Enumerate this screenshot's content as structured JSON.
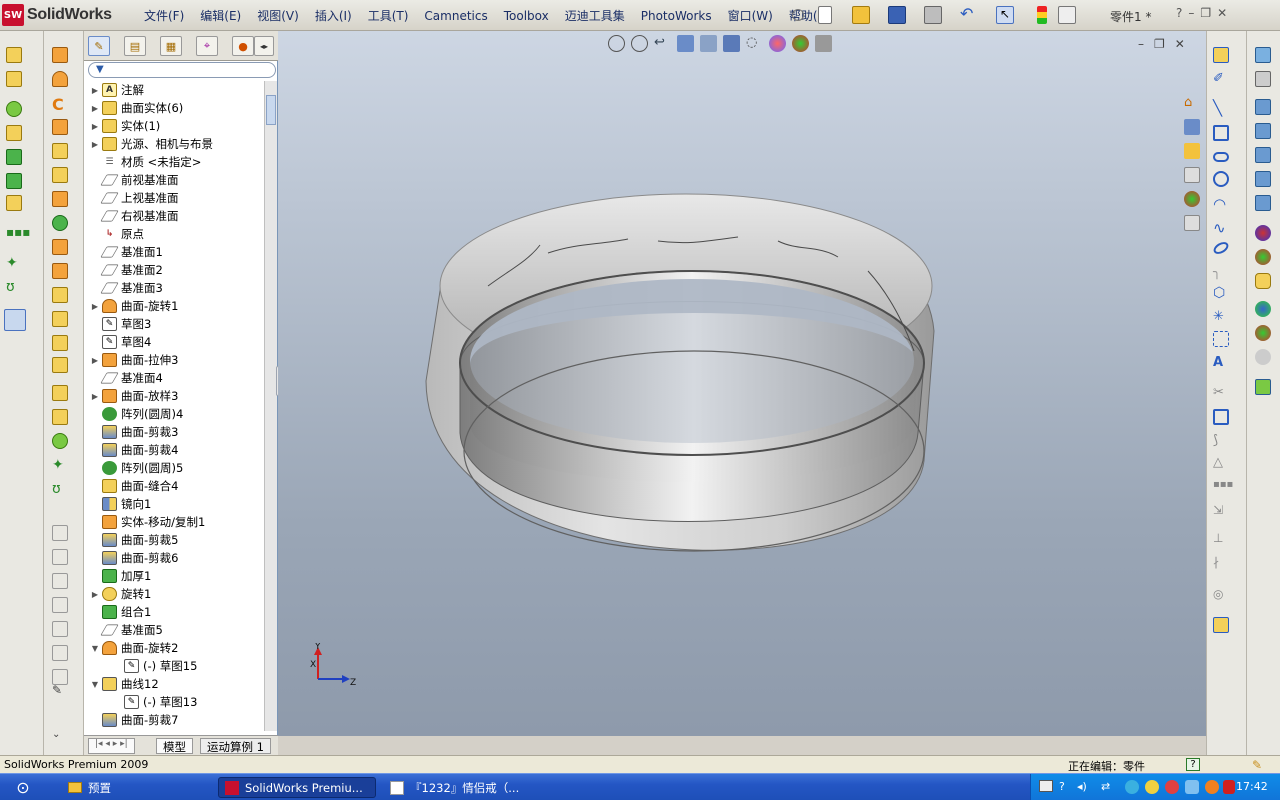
{
  "app": {
    "logo_text": "SolidWorks",
    "logo_badge": "SW",
    "doc_title": "零件1 *"
  },
  "menus": [
    "文件(F)",
    "编辑(E)",
    "视图(V)",
    "插入(I)",
    "工具(T)",
    "Camnetics",
    "Toolbox",
    "迈迪工具集",
    "PhotoWorks",
    "窗口(W)",
    "帮助(H)"
  ],
  "feature_tree": [
    {
      "label": "注解",
      "icon": "annotation-icon",
      "expandable": true,
      "indent": 0
    },
    {
      "label": "曲面实体(6)",
      "icon": "surface-bodies-icon",
      "expandable": true,
      "indent": 0
    },
    {
      "label": "实体(1)",
      "icon": "solid-bodies-icon",
      "expandable": true,
      "indent": 0
    },
    {
      "label": "光源、相机与布景",
      "icon": "lights-icon",
      "expandable": true,
      "indent": 0
    },
    {
      "label": "材质 <未指定>",
      "icon": "material-icon",
      "expandable": false,
      "indent": 0
    },
    {
      "label": "前视基准面",
      "icon": "plane-icon",
      "expandable": false,
      "indent": 0
    },
    {
      "label": "上视基准面",
      "icon": "plane-icon",
      "expandable": false,
      "indent": 0
    },
    {
      "label": "右视基准面",
      "icon": "plane-icon",
      "expandable": false,
      "indent": 0
    },
    {
      "label": "原点",
      "icon": "origin-icon",
      "expandable": false,
      "indent": 0
    },
    {
      "label": "基准面1",
      "icon": "plane-icon",
      "expandable": false,
      "indent": 0
    },
    {
      "label": "基准面2",
      "icon": "plane-icon",
      "expandable": false,
      "indent": 0
    },
    {
      "label": "基准面3",
      "icon": "plane-icon",
      "expandable": false,
      "indent": 0
    },
    {
      "label": "曲面-旋转1",
      "icon": "surface-revolve-icon",
      "expandable": true,
      "indent": 0
    },
    {
      "label": "草图3",
      "icon": "sketch-icon",
      "expandable": false,
      "indent": 0
    },
    {
      "label": "草图4",
      "icon": "sketch-icon",
      "expandable": false,
      "indent": 0
    },
    {
      "label": "曲面-拉伸3",
      "icon": "surface-extrude-icon",
      "expandable": true,
      "indent": 0
    },
    {
      "label": "基准面4",
      "icon": "plane-icon",
      "expandable": false,
      "indent": 0
    },
    {
      "label": "曲面-放样3",
      "icon": "surface-loft-icon",
      "expandable": true,
      "indent": 0
    },
    {
      "label": "阵列(圆周)4",
      "icon": "circular-pattern-icon",
      "expandable": false,
      "indent": 0
    },
    {
      "label": "曲面-剪裁3",
      "icon": "surface-trim-icon",
      "expandable": false,
      "indent": 0
    },
    {
      "label": "曲面-剪裁4",
      "icon": "surface-trim-icon",
      "expandable": false,
      "indent": 0
    },
    {
      "label": "阵列(圆周)5",
      "icon": "circular-pattern-icon",
      "expandable": false,
      "indent": 0
    },
    {
      "label": "曲面-缝合4",
      "icon": "surface-knit-icon",
      "expandable": false,
      "indent": 0
    },
    {
      "label": "镜向1",
      "icon": "mirror-icon",
      "expandable": false,
      "indent": 0
    },
    {
      "label": "实体-移动/复制1",
      "icon": "move-copy-icon",
      "expandable": false,
      "indent": 0
    },
    {
      "label": "曲面-剪裁5",
      "icon": "surface-trim-icon",
      "expandable": false,
      "indent": 0
    },
    {
      "label": "曲面-剪裁6",
      "icon": "surface-trim-icon",
      "expandable": false,
      "indent": 0
    },
    {
      "label": "加厚1",
      "icon": "thicken-icon",
      "expandable": false,
      "indent": 0
    },
    {
      "label": "旋转1",
      "icon": "revolve-icon",
      "expandable": true,
      "indent": 0
    },
    {
      "label": "组合1",
      "icon": "combine-icon",
      "expandable": false,
      "indent": 0
    },
    {
      "label": "基准面5",
      "icon": "plane-icon",
      "expandable": false,
      "indent": 0
    },
    {
      "label": "曲面-旋转2",
      "icon": "surface-revolve-icon",
      "expandable": true,
      "expanded": true,
      "indent": 0
    },
    {
      "label": "(-) 草图15",
      "icon": "sketch-icon",
      "expandable": false,
      "indent": 1
    },
    {
      "label": "曲线12",
      "icon": "curve-icon",
      "expandable": true,
      "expanded": true,
      "indent": 0
    },
    {
      "label": "(-) 草图13",
      "icon": "sketch-icon",
      "expandable": false,
      "indent": 1
    },
    {
      "label": "曲面-剪裁7",
      "icon": "surface-trim-icon",
      "expandable": false,
      "indent": 0
    }
  ],
  "fm_bottom_tabs": [
    "模型",
    "运动算例 1"
  ],
  "status": {
    "left": "SolidWorks Premium 2009",
    "right": "正在编辑：零件"
  },
  "taskbar": {
    "start_label": "",
    "items": [
      {
        "label": "预置"
      },
      {
        "label": "SolidWorks Premiu..."
      },
      {
        "label": "『1232』情侣戒（..."
      }
    ],
    "clock": "17:42"
  },
  "triad": {
    "x": "X",
    "y": "Y",
    "z": "Z"
  },
  "colors": {
    "viewport_top": "#cdd6e3",
    "viewport_bottom": "#8e9aab",
    "accent_blue": "#2456c4",
    "brand_red": "#c8102e"
  }
}
